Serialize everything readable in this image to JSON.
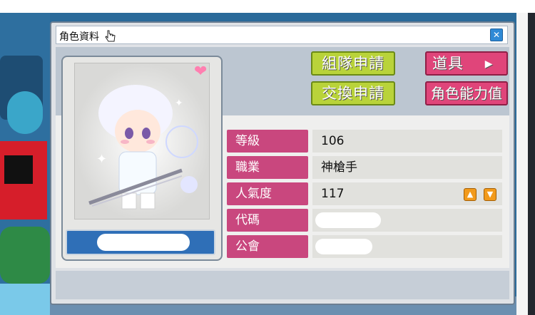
{
  "window": {
    "title": "角色資料",
    "close_icon": "close-icon"
  },
  "buttons": {
    "party_request": "組隊申請",
    "trade_request": "交換申請",
    "items": "道具",
    "stats": "角色能力值"
  },
  "character": {
    "name": "",
    "heart_icon": "heart-icon"
  },
  "stats": {
    "level_label": "等級",
    "level_value": "106",
    "job_label": "職業",
    "job_value": "神槍手",
    "fame_label": "人氣度",
    "fame_value": "117",
    "code_label": "代碼",
    "code_value": "",
    "guild_label": "公會",
    "guild_value": ""
  },
  "colors": {
    "accent_pink": "#c9477e",
    "accent_green": "#b9d33a",
    "name_bar": "#2f6fb7"
  }
}
